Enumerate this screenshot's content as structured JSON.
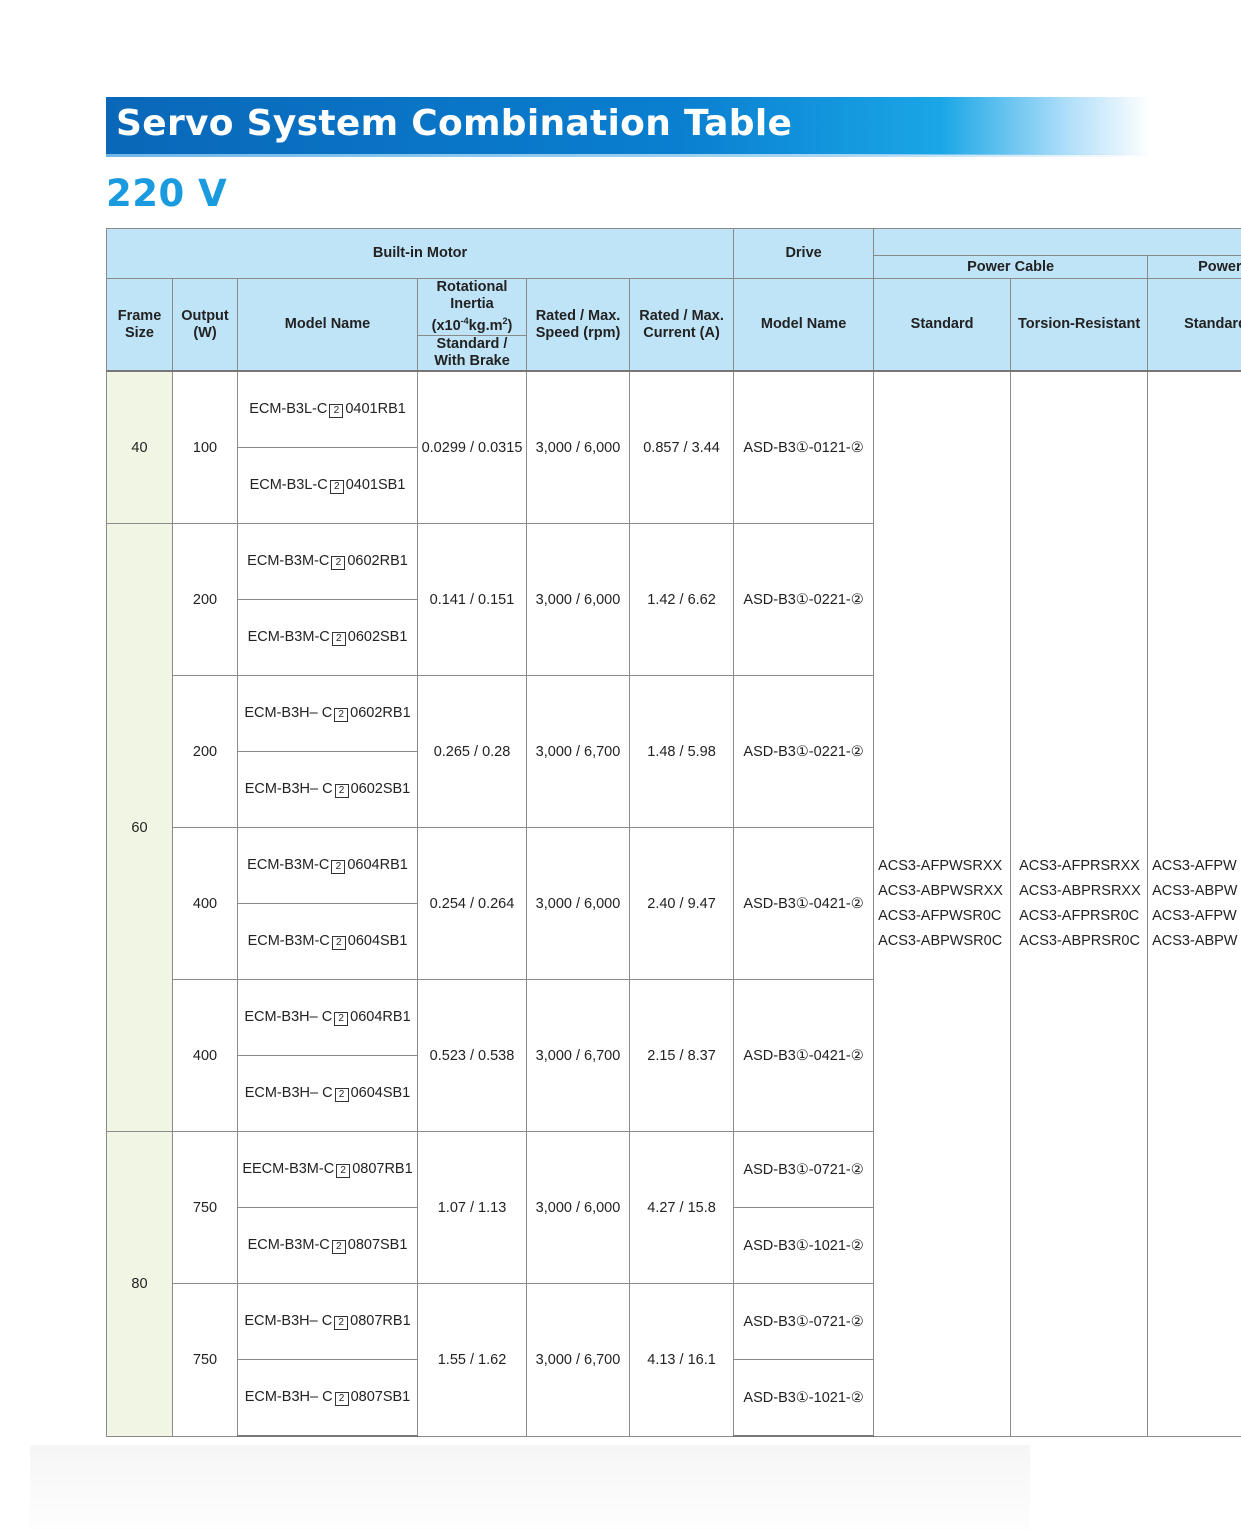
{
  "title": "Servo System Combination Table",
  "voltage": "220 V",
  "headers": {
    "built_in_motor": "Built-in Motor",
    "drive": "Drive",
    "power_cable": "Power Cable",
    "power_cable_2": "Power",
    "frame_size": "Frame Size",
    "output": "Output (W)",
    "model_name": "Model Name",
    "inertia_1": "Rotational",
    "inertia_2": "Inertia",
    "inertia_3": "(x10",
    "inertia_exp": "-4",
    "inertia_4": "kg.m",
    "inertia_exp2": "2",
    "inertia_5": ")",
    "inertia_sub": "Standard / With Brake",
    "speed": "Rated / Max. Speed (rpm)",
    "current": "Rated / Max. Current (A)",
    "drive_model": "Model Name",
    "standard": "Standard",
    "torsion": "Torsion-Resistant",
    "standard_2": "Standard"
  },
  "frames": [
    "40",
    "60",
    "80"
  ],
  "rows": [
    {
      "output": "100",
      "motors": [
        "ECM-B3L-C",
        "0401RB1",
        "ECM-B3L-C",
        "0401SB1"
      ],
      "inertia": "0.0299 / 0.0315",
      "speed": "3,000 / 6,000",
      "current": "0.857 / 3.44",
      "drives": [
        "ASD-B3①-0121-②"
      ]
    },
    {
      "output": "200",
      "motors": [
        "ECM-B3M-C",
        "0602RB1",
        "ECM-B3M-C",
        "0602SB1"
      ],
      "inertia": "0.141 / 0.151",
      "speed": "3,000 / 6,000",
      "current": "1.42 / 6.62",
      "drives": [
        "ASD-B3①-0221-②"
      ]
    },
    {
      "output": "200",
      "motors": [
        "ECM-B3H– C",
        "0602RB1",
        "ECM-B3H– C",
        "0602SB1"
      ],
      "inertia": "0.265 / 0.28",
      "speed": "3,000 / 6,700",
      "current": "1.48 / 5.98",
      "drives": [
        "ASD-B3①-0221-②"
      ]
    },
    {
      "output": "400",
      "motors": [
        "ECM-B3M-C",
        "0604RB1",
        "ECM-B3M-C",
        "0604SB1"
      ],
      "inertia": "0.254 / 0.264",
      "speed": "3,000 / 6,000",
      "current": "2.40 / 9.47",
      "drives": [
        "ASD-B3①-0421-②"
      ]
    },
    {
      "output": "400",
      "motors": [
        "ECM-B3H– C",
        "0604RB1",
        "ECM-B3H– C",
        "0604SB1"
      ],
      "inertia": "0.523 / 0.538",
      "speed": "3,000 / 6,700",
      "current": "2.15 / 8.37",
      "drives": [
        "ASD-B3①-0421-②"
      ]
    },
    {
      "output": "750",
      "motors": [
        "EECM-B3M-C",
        "0807RB1",
        "ECM-B3M-C",
        "0807SB1"
      ],
      "inertia": "1.07 / 1.13",
      "speed": "3,000 / 6,000",
      "current": "4.27 / 15.8",
      "drives": [
        "ASD-B3①-0721-②",
        "ASD-B3①-1021-②"
      ]
    },
    {
      "output": "750",
      "motors": [
        "ECM-B3H– C",
        "0807RB1",
        "ECM-B3H– C",
        "0807SB1"
      ],
      "inertia": "1.55 / 1.62",
      "speed": "3,000 / 6,700",
      "current": "4.13 / 16.1",
      "drives": [
        "ASD-B3①-0721-②",
        "ASD-B3①-1021-②"
      ]
    }
  ],
  "box_char": "2",
  "cables": {
    "standard": [
      "ACS3-AFPWSRXX",
      "ACS3-ABPWSRXX",
      "ACS3-AFPWSR0C",
      "ACS3-ABPWSR0C"
    ],
    "torsion": [
      "ACS3-AFPRSRXX",
      "ACS3-ABPRSRXX",
      "ACS3-AFPRSR0C",
      "ACS3-ABPRSR0C"
    ],
    "standard_2": [
      "ACS3-AFPW",
      "ACS3-ABPW",
      "ACS3-AFPW",
      "ACS3-ABPW"
    ]
  }
}
